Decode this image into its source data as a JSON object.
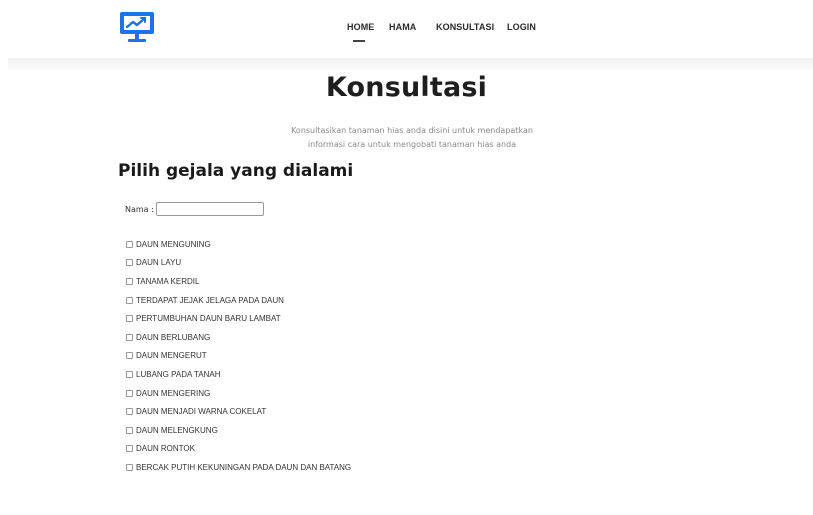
{
  "navbar": {
    "logo_icon": "monitor-chart-icon",
    "brand_color": "#1a73e8",
    "menu": [
      {
        "label": "HOME",
        "active": true
      },
      {
        "label": "HAMA",
        "active": false
      },
      {
        "label": "KONSULTASI",
        "active": false
      },
      {
        "label": "LOGIN",
        "active": false
      }
    ]
  },
  "main": {
    "title": "Konsultasi",
    "subtitle_line1": "Konsultasikan tanaman hias anda disini untuk mendapatkan",
    "subtitle_line2": "informasi cara untuk mengobati tanaman hias anda",
    "section_heading": "Pilih gejala yang dialami",
    "name_label": "Nama :",
    "name_value": "",
    "symptoms": [
      "DAUN MENGUNING",
      "DAUN LAYU",
      "TANAMA KERDIL",
      "TERDAPAT JEJAK JELAGA PADA DAUN",
      "PERTUMBUHAN DAUN BARU LAMBAT",
      "DAUN BERLUBANG",
      "DAUN MENGERUT",
      "LUBANG PADA TANAH",
      "DAUN MENGERING",
      "DAUN MENJADI WARNA COKELAT",
      "DAUN MELENGKUNG",
      "DAUN RONTOK",
      "BERCAK PUTIH KEKUNINGAN PADA DAUN DAN BATANG"
    ]
  }
}
